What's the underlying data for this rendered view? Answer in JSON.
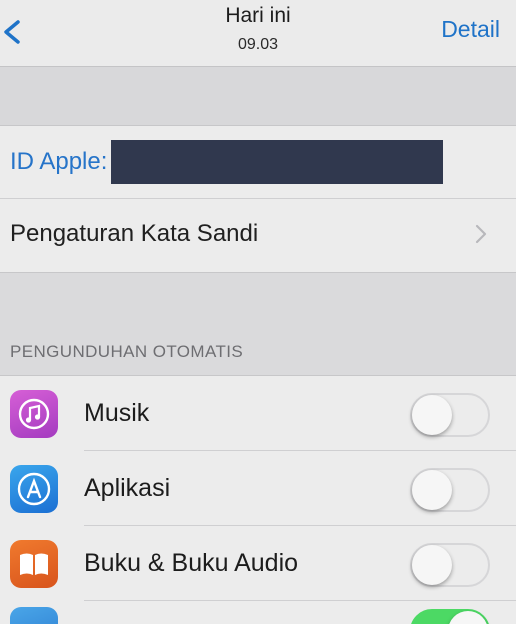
{
  "navbar": {
    "title": "Hari ini",
    "subtitle": "09.03",
    "detail_label": "Detail",
    "back_icon": "chevron-left-icon"
  },
  "account": {
    "apple_id_label": "ID Apple:",
    "apple_id_value": "",
    "password_settings_label": "Pengaturan Kata Sandi",
    "chevron_icon": "chevron-right-icon"
  },
  "auto_downloads": {
    "header": "PENGUNDUHAN OTOMATIS",
    "items": [
      {
        "label": "Musik",
        "icon": "music-icon",
        "enabled": false
      },
      {
        "label": "Aplikasi",
        "icon": "app-store-icon",
        "enabled": false
      },
      {
        "label": "Buku & Buku Audio",
        "icon": "books-icon",
        "enabled": false
      },
      {
        "label": "",
        "icon": "app-store-icon",
        "enabled": true
      }
    ]
  },
  "colors": {
    "accent": "#1f73c8",
    "toggle_on": "#4cd964",
    "redaction": "#30384e"
  }
}
